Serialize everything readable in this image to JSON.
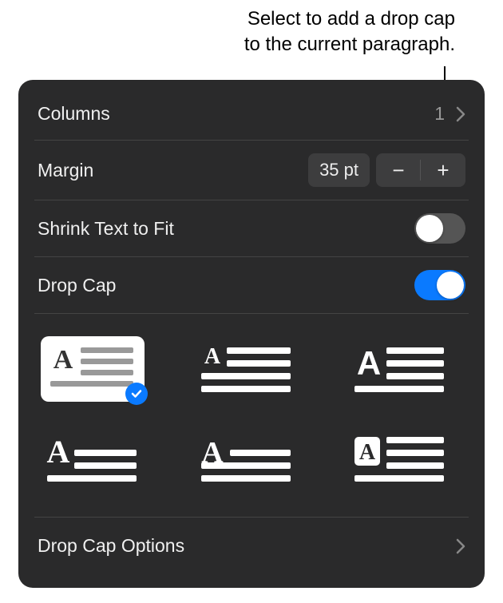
{
  "callout": {
    "line1": "Select to add a drop cap",
    "line2": "to the current paragraph."
  },
  "rows": {
    "columns": {
      "label": "Columns",
      "value": "1"
    },
    "margin": {
      "label": "Margin",
      "value": "35 pt",
      "minus": "−",
      "plus": "+"
    },
    "shrink": {
      "label": "Shrink Text to Fit",
      "enabled": false
    },
    "dropcap": {
      "label": "Drop Cap",
      "enabled": true
    }
  },
  "styles": {
    "selected_index": 0,
    "items": [
      {
        "name": "drop-cap-style-1"
      },
      {
        "name": "drop-cap-style-2"
      },
      {
        "name": "drop-cap-style-3"
      },
      {
        "name": "drop-cap-style-4"
      },
      {
        "name": "drop-cap-style-5"
      },
      {
        "name": "drop-cap-style-6"
      }
    ]
  },
  "options_row": {
    "label": "Drop Cap Options"
  }
}
